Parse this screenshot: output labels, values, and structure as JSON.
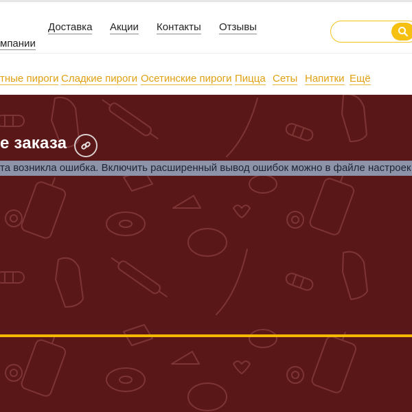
{
  "header": {
    "about_fragment": "мпании",
    "nav": [
      "Доставка",
      "Акции",
      "Контакты",
      "Отзывы"
    ],
    "search": {
      "value": "",
      "placeholder": ""
    }
  },
  "categories": [
    "тные пироги",
    "Сладкие пироги",
    "Осетинские пироги",
    "Пицца",
    "Сеты",
    "Напитки",
    "Ещё"
  ],
  "page": {
    "title_fragment": "е заказа",
    "error_text": "та возникла ошибка. Включить расширенный вывод ошибок можно в файле настроек .setti"
  },
  "colors": {
    "accent": "#f6c011",
    "category_link": "#e0a010",
    "hero_bg": "#5a1717",
    "error_bar": "#8d93a8"
  },
  "icons": {
    "search": "search-icon",
    "link": "link-icon"
  }
}
